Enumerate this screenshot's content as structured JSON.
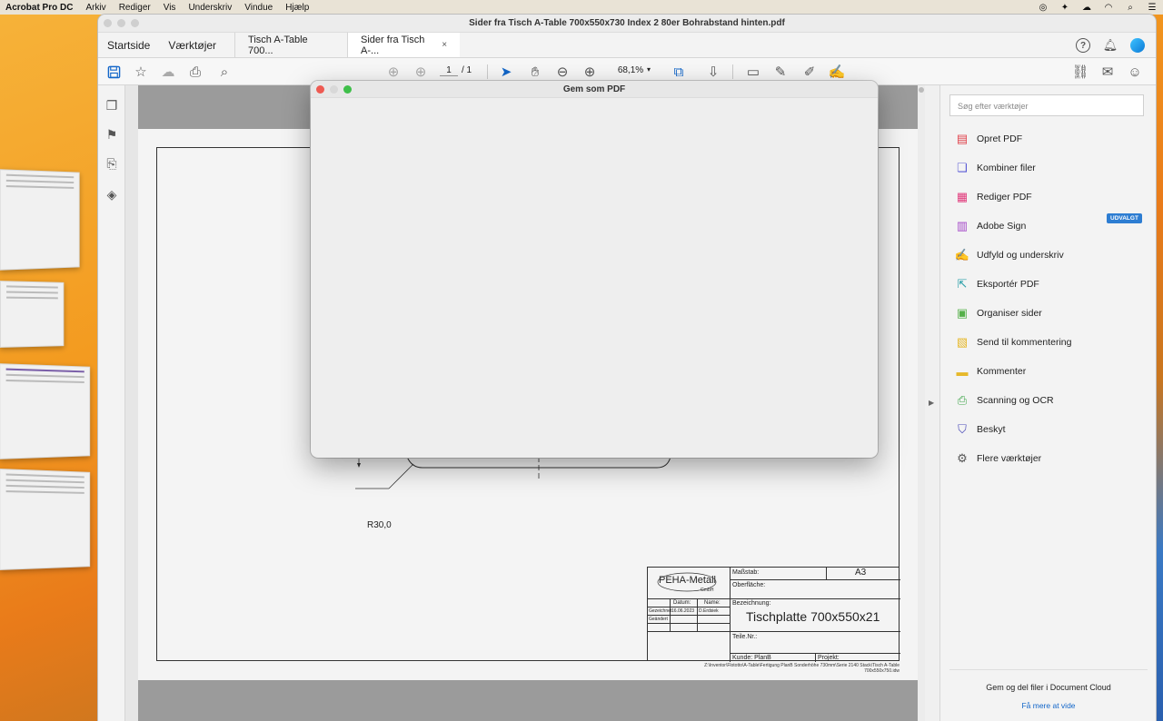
{
  "menubar": {
    "app": "Acrobat Pro DC",
    "items": [
      "Arkiv",
      "Rediger",
      "Vis",
      "Underskriv",
      "Vindue",
      "Hjælp"
    ]
  },
  "window": {
    "title": "Sider fra Tisch A-Table 700x550x730 Index 2 80er Bohrabstand hinten.pdf"
  },
  "tabs": {
    "home": "Startside",
    "tools": "Værktøjer",
    "doc1": "Tisch A-Table 700...",
    "doc2": "Sider fra Tisch A-...",
    "close": "×"
  },
  "toolbar": {
    "page_current": "1",
    "page_total": "/  1",
    "zoom": "68,1%",
    "zoom_caret": "▾"
  },
  "document": {
    "radius_label": "R30,0",
    "titleblock": {
      "logo": "PEHA-Metall",
      "logo_sub": "GmbH",
      "massstab_label": "Maßstab:",
      "massstab_value": "A3",
      "oberflaeche": "Oberfläche:",
      "datum_label": "Datum:",
      "name_label": "Name:",
      "gezeichnet": "Gezeichnet",
      "gezeichnet_date": "16.06.2023",
      "gezeichnet_name": "D.Erdsiek",
      "geaendert": "Geändert",
      "bezeichnung_label": "Bezeichnung:",
      "bezeichnung_value": "Tischplatte 700x550x21",
      "teile_nr": "Teile.Nr.:",
      "kunde": "Kunde: PlanB",
      "projekt": "Projekt:"
    },
    "path_line1": "Z:\\Inventor\\Flototto\\A-Table\\Fertigung PlanB Sonderhöhe 730mm\\Serie 2140 Stack\\Tisch A-Table",
    "path_line2": "700x550x750.idw"
  },
  "dialog": {
    "title": "Gem som PDF"
  },
  "rightpanel": {
    "search_placeholder": "Søg efter værktøjer",
    "tools": [
      {
        "label": "Opret PDF",
        "icon": "create-pdf-icon",
        "color": "#e0424b"
      },
      {
        "label": "Kombiner filer",
        "icon": "combine-files-icon",
        "color": "#5b5bd6"
      },
      {
        "label": "Rediger PDF",
        "icon": "edit-pdf-icon",
        "color": "#e0387a"
      },
      {
        "label": "Adobe Sign",
        "icon": "adobe-sign-icon",
        "color": "#a447c8"
      },
      {
        "label": "Udfyld og underskriv",
        "icon": "fill-sign-icon",
        "color": "#8a4fd2"
      },
      {
        "label": "Eksportér PDF",
        "icon": "export-pdf-icon",
        "color": "#2a9fa8"
      },
      {
        "label": "Organiser sider",
        "icon": "organize-pages-icon",
        "color": "#55b04a"
      },
      {
        "label": "Send til kommentering",
        "icon": "send-comment-icon",
        "color": "#e6b82a"
      },
      {
        "label": "Kommenter",
        "icon": "comment-icon",
        "color": "#e6b82a"
      },
      {
        "label": "Scanning og OCR",
        "icon": "scan-ocr-icon",
        "color": "#3fa64a"
      },
      {
        "label": "Beskyt",
        "icon": "protect-icon",
        "color": "#4b4bb8"
      },
      {
        "label": "Flere værktøjer",
        "icon": "more-tools-icon",
        "color": "#555555"
      }
    ],
    "badge": "UDVALGT",
    "cloud_title": "Gem og del filer i Document Cloud",
    "cloud_link": "Få mere at vide"
  }
}
